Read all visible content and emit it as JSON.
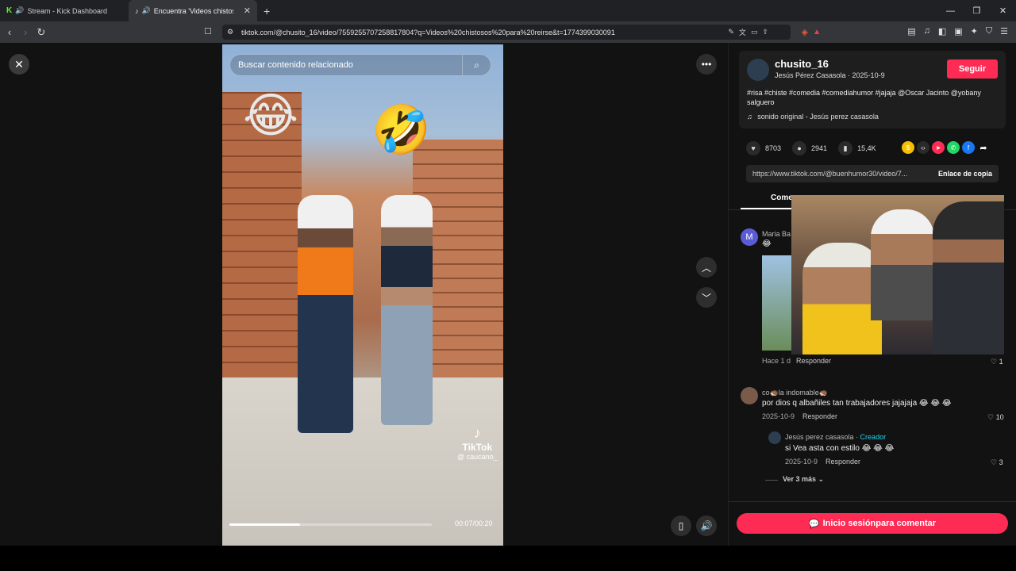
{
  "browser": {
    "tabs": [
      {
        "title": "Stream - Kick Dashboard"
      },
      {
        "title": "Encuentra 'Videos chistosos p"
      }
    ],
    "url": "tiktok.com/@chusito_16/video/7559255707258817804?q=Videos%20chistosos%20para%20reirse&t=1774399030091"
  },
  "video": {
    "search_placeholder": "Buscar contenido relacionado",
    "time": "00:07/00:20",
    "progress_fraction": 0.35,
    "watermark_brand": "TikTok",
    "watermark_user": "@ caucano_"
  },
  "post": {
    "username": "chusito_16",
    "subtitle": "Jesús Pérez Casasola · 2025-10-9",
    "follow_label": "Seguir",
    "description": "#risa #chiste #comedia #comediahumor #jajaja @Oscar Jacinto @yobany salguero",
    "sound": "sonido original - Jesús perez casasola",
    "likes": "8703",
    "comments": "2941",
    "saves": "15,4K",
    "share_link": "https://www.tiktok.com/@buenhumor30/video/7...",
    "copy_label": "Enlace de copia"
  },
  "comments_tab": "Come",
  "comments": [
    {
      "user": "Maria Ba",
      "avatar_letter": "M",
      "time": "Hace 1 d",
      "reply": "Responder",
      "likes": "1"
    },
    {
      "user": "co🦔la indomable🦔",
      "text": "por dios q albañiles tan trabajadores jajajaja 😂 😂 😂",
      "time": "2025-10-9",
      "reply": "Responder",
      "likes": "10"
    },
    {
      "user": "Jesús perez casasola",
      "badge": "· Creador",
      "text": "si Vea asta con estilo 😂 😂 😂",
      "time": "2025-10-9",
      "reply": "Responder",
      "likes": "3"
    }
  ],
  "see_more": "Ver 3 más",
  "login_label": "Inicio sesiónpara comentar",
  "colors": {
    "accent": "#fe2c55",
    "creator": "#20d5ec"
  }
}
